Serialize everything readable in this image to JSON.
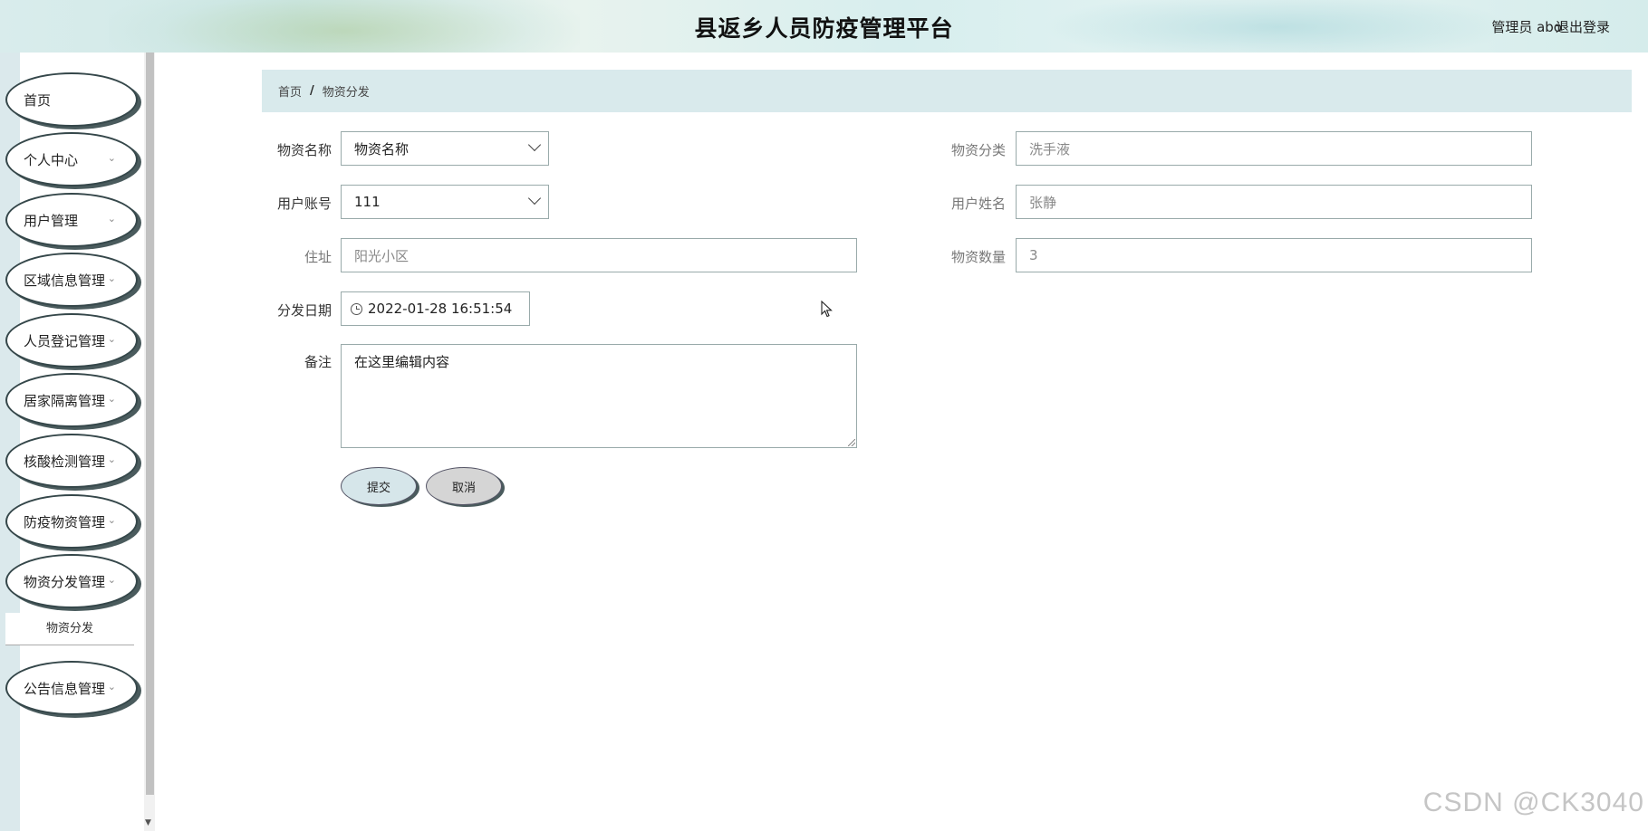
{
  "header": {
    "title": "县返乡人员防疫管理平台",
    "user": "管理员 abo",
    "logout": "退出登录"
  },
  "sidebar": {
    "items": [
      {
        "label": "首页",
        "has_chevron": false
      },
      {
        "label": "个人中心",
        "has_chevron": true
      },
      {
        "label": "用户管理",
        "has_chevron": true
      },
      {
        "label": "区域信息管理",
        "has_chevron": true
      },
      {
        "label": "人员登记管理",
        "has_chevron": true
      },
      {
        "label": "居家隔离管理",
        "has_chevron": true
      },
      {
        "label": "核酸检测管理",
        "has_chevron": true
      },
      {
        "label": "防疫物资管理",
        "has_chevron": true
      },
      {
        "label": "物资分发管理",
        "has_chevron": true
      },
      {
        "label": "公告信息管理",
        "has_chevron": true
      }
    ],
    "submenu": "物资分发"
  },
  "breadcrumb": {
    "home": "首页",
    "separator": "/",
    "current": "物资分发"
  },
  "form": {
    "material_name": {
      "label": "物资名称",
      "value": "物资名称"
    },
    "material_category": {
      "label": "物资分类",
      "value": "洗手液"
    },
    "user_account": {
      "label": "用户账号",
      "value": "111"
    },
    "user_name": {
      "label": "用户姓名",
      "value": "张静"
    },
    "address": {
      "label": "住址",
      "value": "阳光小区"
    },
    "material_quantity": {
      "label": "物资数量",
      "value": "3"
    },
    "dispatch_date": {
      "label": "分发日期",
      "value": "2022-01-28 16:51:54"
    },
    "remark": {
      "label": "备注",
      "value": "在这里编辑内容"
    }
  },
  "buttons": {
    "submit": "提交",
    "cancel": "取消"
  },
  "watermark": "CSDN @CK3040",
  "icons": {
    "chevron": "chevron-down-icon",
    "clock": "clock-icon",
    "cursor": "mouse-cursor-icon"
  },
  "colors": {
    "breadcrumb_bg": "#d9eaec",
    "submit_bg": "#d6e6ea",
    "cancel_bg": "#d5d5d5",
    "menu_border": "#35474a"
  }
}
